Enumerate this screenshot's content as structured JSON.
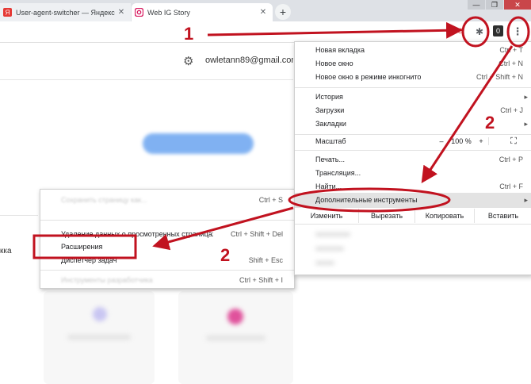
{
  "tabs": [
    {
      "title": "User-agent-switcher — Яндекс",
      "favicon_color": "#e53935",
      "close": "✕"
    },
    {
      "title": "Web IG Story",
      "favicon_color": "#d81b60",
      "close": "✕"
    }
  ],
  "new_tab_label": "+",
  "window_controls": {
    "minimize": "—",
    "maximize": "❐",
    "close": "✕"
  },
  "toolbar": {
    "extension_badge": "0",
    "red_ext_icon": "⊖",
    "puzzle_icon": "✱",
    "menu_icon": "⋮"
  },
  "page": {
    "email": "owletann89@gmail.com",
    "sidebar_fragment": "кка"
  },
  "main_menu": {
    "items": [
      {
        "label": "Новая вкладка",
        "shortcut": "Ctrl + T"
      },
      {
        "label": "Новое окно",
        "shortcut": "Ctrl + N"
      },
      {
        "label": "Новое окно в режиме инкогнито",
        "shortcut": "Ctrl + Shift + N"
      },
      {
        "label": "История",
        "shortcut": "▸"
      },
      {
        "label": "Загрузки",
        "shortcut": "Ctrl + J"
      },
      {
        "label": "Закладки",
        "shortcut": "▸"
      },
      {
        "label": "Печать...",
        "shortcut": "Ctrl + P"
      },
      {
        "label": "Трансляция...",
        "shortcut": ""
      },
      {
        "label": "Найти...",
        "shortcut": "Ctrl + F"
      },
      {
        "label": "Дополнительные инструменты",
        "shortcut": "▸"
      }
    ],
    "zoom": {
      "label": "Масштаб",
      "minus": "–",
      "value": "100 %",
      "plus": "+",
      "fullscreen": "⛶"
    },
    "edit": {
      "label": "Изменить",
      "cut": "Вырезать",
      "copy": "Копировать",
      "paste": "Вставить"
    }
  },
  "sub_menu": {
    "items": [
      {
        "label": "Сохранить страницу как...",
        "shortcut": "Ctrl + S"
      },
      {
        "label": "Удаление данных о просмотренных страницах...",
        "shortcut": "Ctrl + Shift + Del"
      },
      {
        "label": "Расширения",
        "shortcut": ""
      },
      {
        "label": "Диспетчер задач",
        "shortcut": "Shift + Esc"
      },
      {
        "label": "Инструменты разработчика",
        "shortcut": "Ctrl + Shift + I"
      }
    ]
  },
  "annotations": {
    "step_1": "1",
    "step_2_main": "2",
    "step_2_sub": "2",
    "color": "#c1121f"
  }
}
